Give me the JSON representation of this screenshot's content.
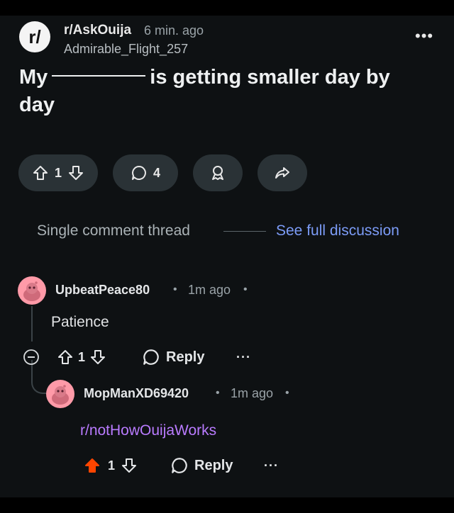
{
  "post": {
    "subreddit_icon": "r/",
    "subreddit": "r/AskOuija",
    "time": "6 min. ago",
    "author": "Admirable_Flight_257",
    "title_start": "My",
    "title_end": "is getting smaller day by day",
    "votes": "1",
    "comments": "4",
    "menu_icon": "ellipsis-icon"
  },
  "thread": {
    "label": "Single comment thread",
    "see_full": "See full discussion"
  },
  "comments": [
    {
      "user": "UpbeatPeace80",
      "time": "1m ago",
      "body": "Patience",
      "votes": "1",
      "reply_label": "Reply",
      "more": "···"
    },
    {
      "user": "MopManXD69420",
      "time": "1m ago",
      "body": "r/notHowOuijaWorks",
      "votes": "1",
      "reply_label": "Reply",
      "more": "···",
      "upvoted": true
    }
  ],
  "colors": {
    "background": "#0e1113",
    "link": "#7c9cf7",
    "subreddit_link": "#b97bff",
    "upvote_active": "#ff4500",
    "avatar": "#ff9aa8"
  }
}
